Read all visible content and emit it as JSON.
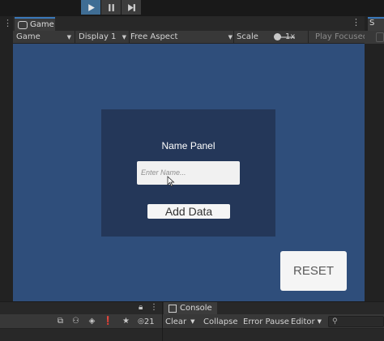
{
  "toolbar_top": {
    "play_icon": "play-icon",
    "pause_icon": "pause-icon",
    "step_icon": "step-icon"
  },
  "game_window": {
    "tab_label": "Game",
    "toolbar": {
      "mode": "Game",
      "display": "Display 1",
      "aspect": "Free Aspect",
      "scale_label": "Scale",
      "scale_value": "1x",
      "play_focused": "Play Focused"
    }
  },
  "inspector_tab_label": "S",
  "scene": {
    "panel_title": "Name Panel",
    "input_placeholder": "Enter Name...",
    "add_button": "Add Data",
    "reset_button": "RESET",
    "background_color": "#2f4e7b",
    "panel_color": "#243759"
  },
  "console": {
    "tab_label": "Console",
    "clear": "Clear",
    "collapse": "Collapse",
    "error_pause": "Error Pause",
    "editor": "Editor",
    "hidden_count": "21",
    "search_placeholder": "Q"
  }
}
